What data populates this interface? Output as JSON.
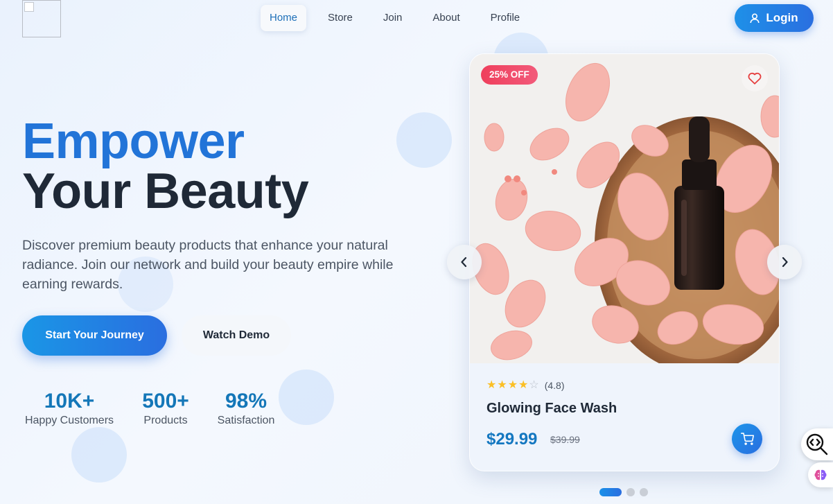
{
  "nav": {
    "items": [
      {
        "label": "Home",
        "active": true
      },
      {
        "label": "Store",
        "active": false
      },
      {
        "label": "Join",
        "active": false
      },
      {
        "label": "About",
        "active": false
      },
      {
        "label": "Profile",
        "active": false
      }
    ],
    "login_label": "Login",
    "login_icon": "user-icon",
    "logo_icon": "broken-image-icon"
  },
  "hero": {
    "title_line1": "Empower",
    "title_line2": "Your Beauty",
    "description": "Discover premium beauty products that enhance your natural radiance. Join our network and build your beauty empire while earning rewards.",
    "primary_cta": "Start Your Journey",
    "secondary_cta": "Watch Demo"
  },
  "stats": [
    {
      "value": "10K+",
      "label": "Happy Customers"
    },
    {
      "value": "500+",
      "label": "Products"
    },
    {
      "value": "98%",
      "label": "Satisfaction"
    }
  ],
  "product": {
    "discount": "25% OFF",
    "rating": 4,
    "rating_max": 5,
    "rating_text": "(4.8)",
    "name": "Glowing Face Wash",
    "price": "$29.99",
    "old_price": "$39.99",
    "favorite_icon": "heart-icon",
    "cart_icon": "cart-icon"
  },
  "carousel": {
    "prev_icon": "chevron-left-icon",
    "next_icon": "chevron-right-icon",
    "slides": 3,
    "active_slide": 1
  },
  "colors": {
    "accent": "#2274d8",
    "price": "#1477c0",
    "discount": "#ef3f5c",
    "star": "#fbbf24"
  }
}
